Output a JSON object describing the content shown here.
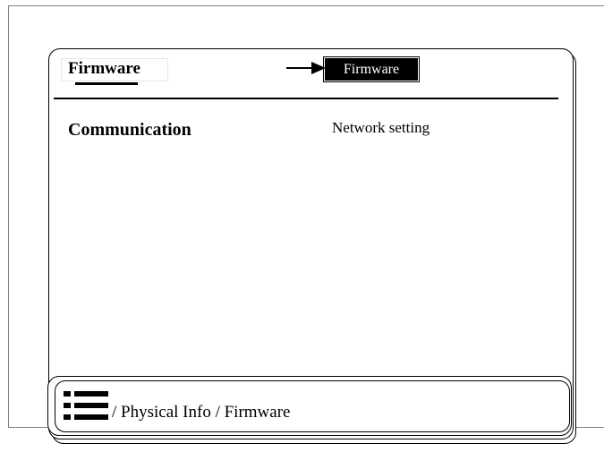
{
  "header": {
    "tab_title": "Firmware",
    "active_label": "Firmware"
  },
  "content": {
    "row_label": "Communication",
    "row_value": "Network setting"
  },
  "footer": {
    "icon": "menu-icon",
    "breadcrumb": "/ Physical Info / Firmware"
  }
}
